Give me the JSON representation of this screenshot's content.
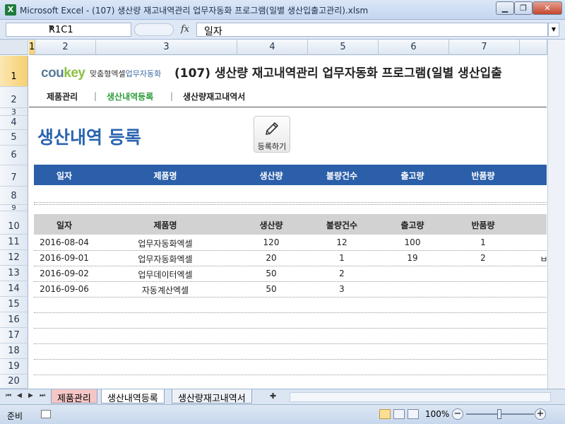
{
  "window": {
    "title": "Microsoft Excel - (107) 생산량 재고내역관리 업무자동화 프로그램(일별 생산입출고관리).xlsm",
    "app_icon": "X",
    "minimize": "▁",
    "restore": "❐",
    "close": "✕"
  },
  "formula_bar": {
    "name_box": "R1C1",
    "fx": "fx",
    "content": "일자"
  },
  "columns": [
    "1",
    "2",
    "3",
    "4",
    "5",
    "6",
    "7"
  ],
  "rows": [
    "1",
    "2",
    "3",
    "4",
    "5",
    "6",
    "7",
    "8",
    "9",
    "10",
    "11",
    "12",
    "13",
    "14",
    "15",
    "16",
    "17",
    "18",
    "19",
    "20"
  ],
  "brand": {
    "logo_cou": "cou",
    "logo_key": "key",
    "tagline_a": "맞춤형엑셀",
    "tagline_b": "업무자동화"
  },
  "page_title": "(107) 생산량 재고내역관리 업무자동화 프로그램(일별 생산입출",
  "nav": {
    "items": [
      "제품관리",
      "생산내역등록",
      "생산량재고내역서"
    ],
    "separator": "|",
    "active_index": 1
  },
  "section_title": "생산내역 등록",
  "register_button": "등록하기",
  "input_header": [
    "일자",
    "제품명",
    "생산량",
    "불량건수",
    "출고량",
    "반품량"
  ],
  "list_header": [
    "일자",
    "제품명",
    "생산량",
    "불량건수",
    "출고량",
    "반품량"
  ],
  "records": [
    {
      "date": "2016-08-04",
      "product": "업무자동화엑셀",
      "produced": "120",
      "defects": "12",
      "shipped": "100",
      "returned": "1",
      "extra": ""
    },
    {
      "date": "2016-09-01",
      "product": "업무자동화엑셀",
      "produced": "20",
      "defects": "1",
      "shipped": "19",
      "returned": "2",
      "extra": "ㅂ"
    },
    {
      "date": "2016-09-02",
      "product": "업무데이터엑셀",
      "produced": "50",
      "defects": "2",
      "shipped": "",
      "returned": "",
      "extra": ""
    },
    {
      "date": "2016-09-06",
      "product": "자동계산엑셀",
      "produced": "50",
      "defects": "3",
      "shipped": "",
      "returned": "",
      "extra": ""
    }
  ],
  "sheet_tabs": [
    {
      "label": "제품관리",
      "color": "#f4c6c6"
    },
    {
      "label": "생산내역등록",
      "color": "#ffffff"
    },
    {
      "label": "생산량재고내역서",
      "color": "#eef2f8"
    }
  ],
  "tab_nav": [
    "⏮",
    "◀",
    "▶",
    "⏭"
  ],
  "status": {
    "ready": "준비",
    "zoom": "100%",
    "zoom_minus": "−",
    "zoom_plus": "+"
  },
  "colors": {
    "input_header_bg": "#2b5fa9",
    "list_header_bg": "#d2d2d2",
    "section_title": "#2a64b0",
    "nav_active": "#2e9b3a"
  }
}
